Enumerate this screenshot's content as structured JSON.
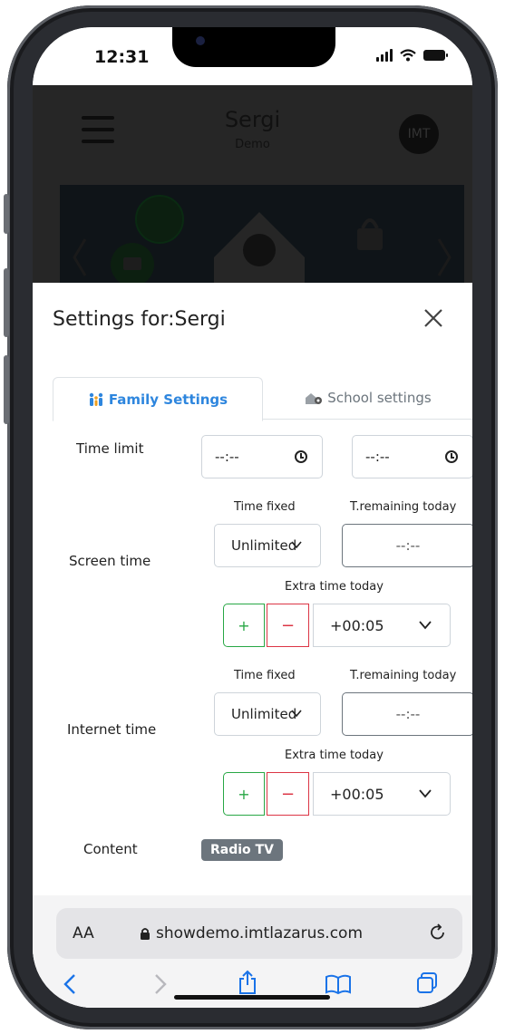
{
  "status": {
    "time": "12:31"
  },
  "background_app": {
    "title": "Sergi",
    "subtitle": "Demo",
    "avatar_text": "IMT"
  },
  "modal": {
    "title": "Settings for:Sergi",
    "tabs": [
      {
        "label": "Family Settings",
        "active": true
      },
      {
        "label": "School settings",
        "active": false
      }
    ],
    "time_limit": {
      "label": "Time limit",
      "from_value": "--:--",
      "to_value": "--:--"
    },
    "screen_time": {
      "label": "Screen time",
      "time_fixed_label": "Time fixed",
      "remaining_label": "T.remaining today",
      "fixed_value": "Unlimited",
      "remaining_value": "--:--",
      "extra_label": "Extra time today",
      "plus": "+",
      "minus": "−",
      "extra_value": "+00:05"
    },
    "internet_time": {
      "label": "Internet time",
      "time_fixed_label": "Time fixed",
      "remaining_label": "T.remaining today",
      "fixed_value": "Unlimited",
      "remaining_value": "--:--",
      "extra_label": "Extra time today",
      "plus": "+",
      "minus": "−",
      "extra_value": "+00:05"
    },
    "content": {
      "label": "Content",
      "badge": "Radio TV"
    }
  },
  "browser": {
    "aa": "AA",
    "url": "showdemo.imtlazarus.com"
  },
  "colors": {
    "accent": "#2e86de",
    "plus": "#28a745",
    "minus": "#dc3545",
    "badge": "#6c757d"
  }
}
